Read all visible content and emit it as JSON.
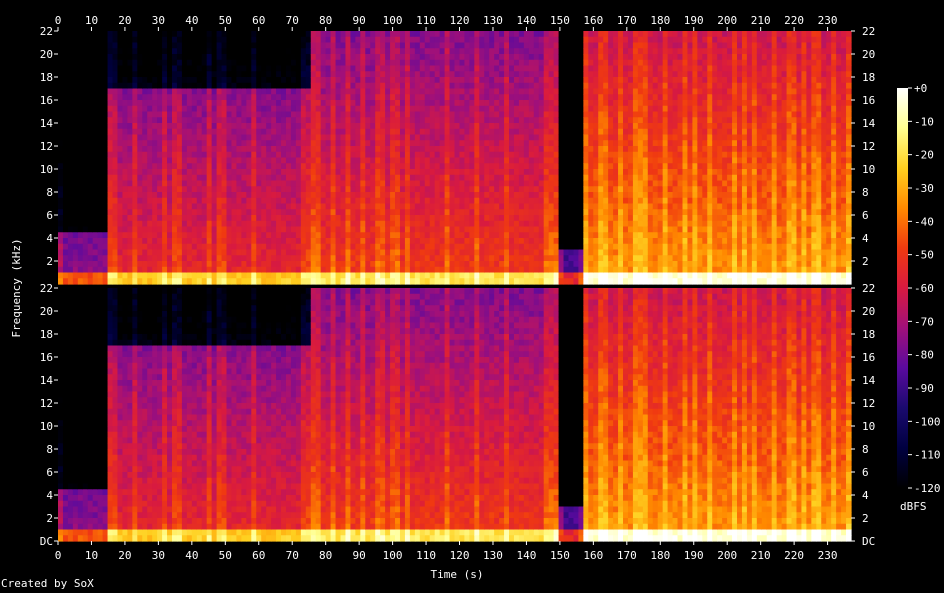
{
  "chart_data": {
    "type": "heatmap",
    "subtype": "spectrogram",
    "channels": 2,
    "xlabel": "Time (s)",
    "ylabel": "Frequency (kHz)",
    "x_ticks": [
      0,
      10,
      20,
      30,
      40,
      50,
      60,
      70,
      80,
      90,
      100,
      110,
      120,
      130,
      140,
      150,
      160,
      170,
      180,
      190,
      200,
      210,
      220,
      230
    ],
    "xlim": [
      0,
      237
    ],
    "y_ticks_top": [
      "2",
      "4",
      "6",
      "8",
      "10",
      "12",
      "14",
      "16",
      "18",
      "20",
      "22"
    ],
    "y_ticks_bottom": [
      "DC",
      "2",
      "4",
      "6",
      "8",
      "10",
      "12",
      "14",
      "16",
      "18",
      "20",
      "22"
    ],
    "y_values": [
      0,
      2,
      4,
      6,
      8,
      10,
      12,
      14,
      16,
      18,
      20,
      22
    ],
    "ylim_khz": [
      0,
      22
    ],
    "colorbar": {
      "label": "dBFS",
      "ticks": [
        "+0",
        "-10",
        "-20",
        "-30",
        "-40",
        "-50",
        "-60",
        "-70",
        "-80",
        "-90",
        "-100",
        "-110",
        "-120"
      ],
      "values": [
        0,
        -10,
        -20,
        -30,
        -40,
        -50,
        -60,
        -70,
        -80,
        -90,
        -100,
        -110,
        -120
      ],
      "range_db": [
        -120,
        0
      ]
    },
    "energy_profile": {
      "description_segments": [
        {
          "t": [
            0,
            15
          ],
          "level": "quiet, energy below 5 kHz"
        },
        {
          "t": [
            15,
            75
          ],
          "level": "moderate, energy up to 17 kHz"
        },
        {
          "t": [
            75,
            150
          ],
          "level": "loud, energy up to 22 kHz"
        },
        {
          "t": [
            150,
            157
          ],
          "level": "quiet gap"
        },
        {
          "t": [
            157,
            237
          ],
          "level": "loudest, full band"
        }
      ]
    },
    "palette": [
      "#000000",
      "#000040",
      "#1a0a6e",
      "#5a0a9e",
      "#a0107a",
      "#d81a40",
      "#f03a10",
      "#ff8a00",
      "#ffd020",
      "#ffff90",
      "#ffffff"
    ]
  },
  "footer": {
    "credit": "Created by SoX"
  }
}
